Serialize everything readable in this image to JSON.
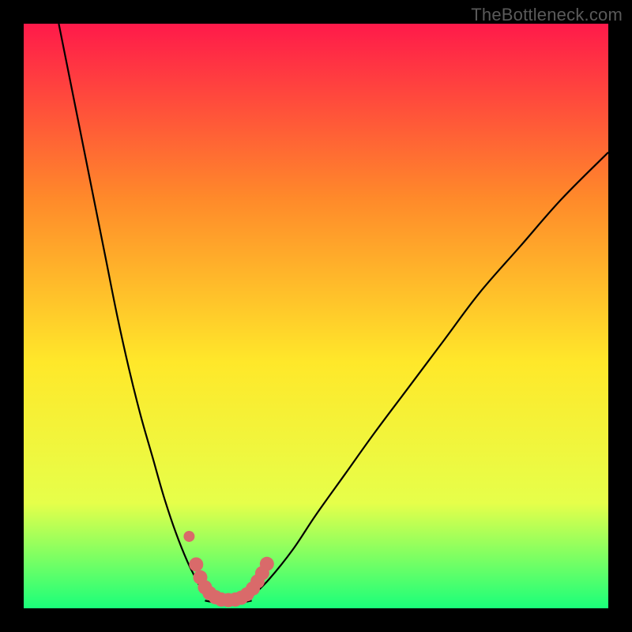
{
  "watermark": "TheBottleneck.com",
  "chart_data": {
    "type": "line",
    "title": "",
    "xlabel": "",
    "ylabel": "",
    "xlim": [
      0,
      100
    ],
    "ylim": [
      0,
      100
    ],
    "background_gradient": {
      "top": "#ff1a4a",
      "upper_mid": "#ff8a2a",
      "mid": "#ffe82a",
      "lower_mid": "#e6ff4a",
      "bottom": "#1aff7a"
    },
    "curve_left": {
      "description": "steep descending left branch of V-curve",
      "x": [
        6,
        8,
        10,
        12,
        14,
        16,
        18,
        20,
        22,
        24,
        26,
        28,
        30,
        31
      ],
      "y": [
        100,
        90,
        80,
        70,
        60,
        50,
        41,
        33,
        26,
        19,
        13,
        8,
        4,
        2
      ]
    },
    "curve_right": {
      "description": "ascending right branch of V-curve (shallower)",
      "x": [
        39,
        42,
        46,
        50,
        55,
        60,
        66,
        72,
        78,
        85,
        92,
        100
      ],
      "y": [
        2,
        5,
        10,
        16,
        23,
        30,
        38,
        46,
        54,
        62,
        70,
        78
      ]
    },
    "bottom_flat": {
      "description": "flat bottom segment near v-dip",
      "x": [
        31,
        33,
        35,
        37,
        39
      ],
      "y": [
        1.3,
        1.0,
        1.0,
        1.0,
        1.3
      ]
    },
    "highlight_dots": {
      "description": "salmon colored thick dotted overlay near dip",
      "color": "#d96a6a",
      "points": [
        {
          "x": 29.5,
          "y": 7.5
        },
        {
          "x": 30.2,
          "y": 5.3
        },
        {
          "x": 31.0,
          "y": 3.6
        },
        {
          "x": 31.8,
          "y": 2.6
        },
        {
          "x": 32.8,
          "y": 1.9
        },
        {
          "x": 33.8,
          "y": 1.5
        },
        {
          "x": 35.0,
          "y": 1.4
        },
        {
          "x": 36.2,
          "y": 1.5
        },
        {
          "x": 37.2,
          "y": 1.8
        },
        {
          "x": 38.2,
          "y": 2.4
        },
        {
          "x": 39.2,
          "y": 3.4
        },
        {
          "x": 40.0,
          "y": 4.6
        },
        {
          "x": 40.8,
          "y": 6.0
        },
        {
          "x": 41.6,
          "y": 7.6
        }
      ]
    },
    "isolated_dot": {
      "color": "#d96a6a",
      "x": 28.3,
      "y": 12.3
    }
  }
}
